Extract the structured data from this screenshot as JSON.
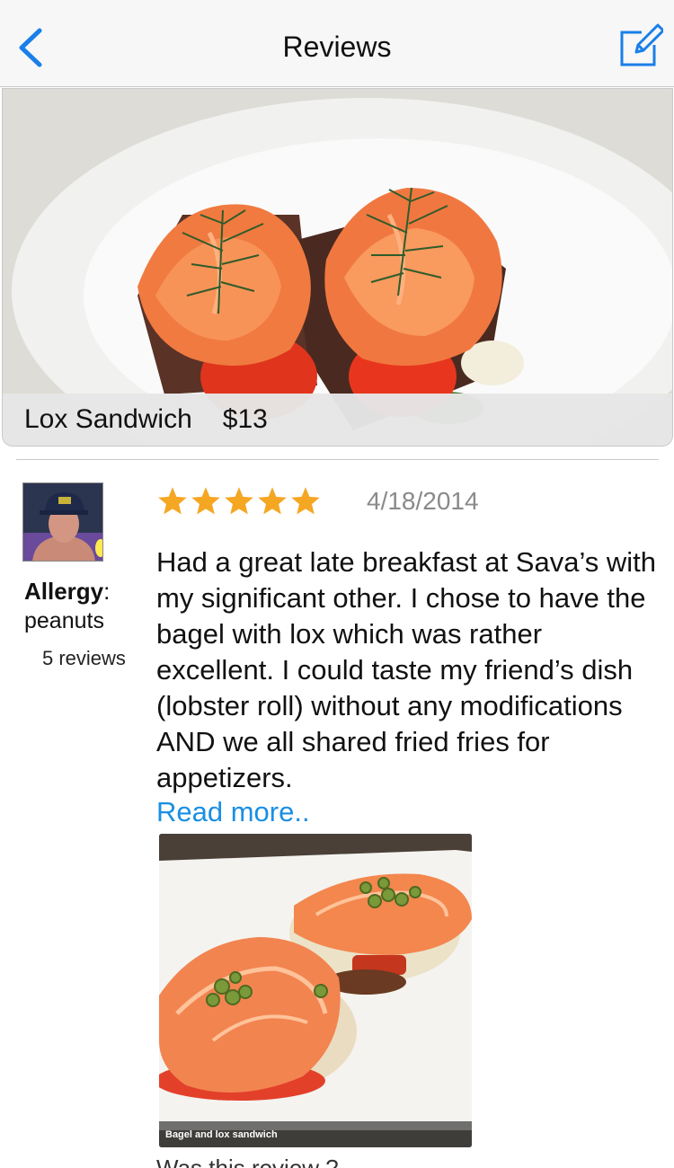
{
  "nav": {
    "title": "Reviews",
    "back_icon": "chevron-left-icon",
    "compose_icon": "compose-icon",
    "accent_color": "#1a7fe8"
  },
  "item": {
    "name": "Lox Sandwich",
    "price": "$13"
  },
  "review": {
    "reviewer": {
      "allergy_label": "Allergy",
      "allergy_value": "peanuts",
      "review_count": "5 reviews"
    },
    "rating": 5,
    "rating_max": 5,
    "star_color": "#f5a623",
    "date": "4/18/2014",
    "text": "Had a great late breakfast at Sava’s with my significant other. I chose to have the bagel with lox which was rather excellent. I could taste my friend’s dish (lobster roll) without any modifications AND we all shared fried fries for appetizers.",
    "read_more": "Read more..",
    "read_more_color": "#1a8fe3",
    "photo_caption": "Bagel and lox sandwich",
    "helpful_prompt": "Was this review ?"
  }
}
